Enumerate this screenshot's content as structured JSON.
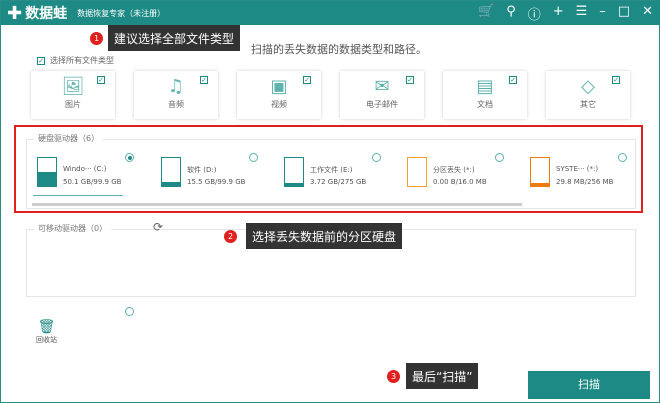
{
  "titlebar": {
    "app_name": "数据蛙",
    "subtitle": "数据恢复专家（未注册）",
    "icons": [
      "cart-icon",
      "key-icon",
      "help-icon",
      "plus-icon",
      "menu-icon",
      "minimize-icon",
      "maximize-icon",
      "close-icon"
    ]
  },
  "hint": "扫描的丢失数据的数据类型和路径。",
  "select_all_label": "选择所有文件类型",
  "file_types": [
    {
      "label": "图片",
      "icon": "image-icon",
      "checked": true
    },
    {
      "label": "音频",
      "icon": "audio-icon",
      "checked": true
    },
    {
      "label": "视频",
      "icon": "video-icon",
      "checked": true
    },
    {
      "label": "电子邮件",
      "icon": "email-icon",
      "checked": true
    },
    {
      "label": "文档",
      "icon": "document-icon",
      "checked": true
    },
    {
      "label": "其它",
      "icon": "other-icon",
      "checked": true
    }
  ],
  "hard_drives": {
    "title": "硬盘驱动器（6）",
    "items": [
      {
        "name": "Windo··· (C:)",
        "size": "50.1 GB/99.9 GB",
        "used": 0.5,
        "color": "#1e8a85",
        "selected": true
      },
      {
        "name": "软件 (D:)",
        "size": "15.5 GB/99.9 GB",
        "used": 0.16,
        "color": "#1e8a85",
        "selected": false
      },
      {
        "name": "工作文件 (E:)",
        "size": "3.72 GB/275 GB",
        "used": 0.02,
        "color": "#1e8a85",
        "selected": false
      },
      {
        "name": "分区丢失 (*:)",
        "size": "0.00  B/16.0 MB",
        "used": 0,
        "color": "#f0a030",
        "selected": false
      },
      {
        "name": "SYSTE··· (*:)",
        "size": "29.8 MB/256 MB",
        "used": 0.12,
        "color": "#f07a10",
        "selected": false
      }
    ]
  },
  "removable": {
    "title": "可移动驱动器（0）"
  },
  "recycle_bin": "回收站",
  "scan_button": "扫描",
  "tips": [
    {
      "num": "1",
      "text": "建议选择全部文件类型"
    },
    {
      "num": "2",
      "text": "选择丢失数据前的分区硬盘"
    },
    {
      "num": "3",
      "text": "最后“扫描”"
    }
  ]
}
